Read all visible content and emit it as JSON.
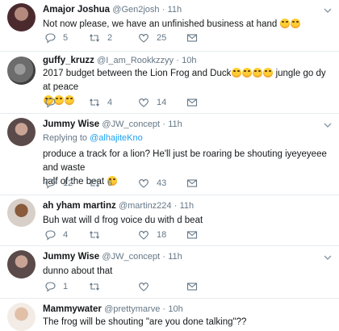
{
  "tweets": [
    {
      "name": "Amajor Joshua",
      "handle": "@Gen2josh",
      "time": "11h",
      "text": "Not now please, we have an unfinished business at hand",
      "emojis": "😂😂",
      "replies": "5",
      "retweets": "2",
      "likes": "25"
    },
    {
      "name": "guffy_kruzz",
      "handle": "@I_am_Rookkzzyy",
      "time": "10h",
      "text_line1": "2017 budget between the Lion Frog and Duck",
      "text_line1_emojis": "😂😂😂😂",
      "text_line1_tail": " jungle go dy at peace",
      "text_line2_emojis": "😂😂😂",
      "replies": "",
      "retweets": "4",
      "likes": "14"
    },
    {
      "name": "Jummy Wise",
      "handle": "@JW_concept",
      "time": "11h",
      "replying_prefix": "Replying to",
      "replying_to": "@alhajiteKno",
      "text_line1": "produce a track for a lion? He'll just be roaring be shouting iyeyeyeee and waste",
      "text_line2": "half of the beat",
      "emoji": "🙄",
      "replies": "12",
      "retweets": "6",
      "likes": "43"
    },
    {
      "name": "ah yham martinz",
      "handle": "@martinz224",
      "time": "11h",
      "text": "Buh wat will d frog voice du with d beat",
      "replies": "4",
      "retweets": "",
      "likes": "18"
    },
    {
      "name": "Jummy Wise",
      "handle": "@JW_concept",
      "time": "11h",
      "text": "dunno about that",
      "replies": "1",
      "retweets": "",
      "likes": ""
    },
    {
      "name": "Mammywater",
      "handle": "@prettymarve",
      "time": "10h",
      "text": "The frog will be shouting \"are you done talking\"??"
    }
  ],
  "separator": "·",
  "colors": {
    "text": "#14171a",
    "muted": "#657786",
    "link": "#1da1f2",
    "border": "#e6ecf0"
  },
  "icons": [
    "reply-icon",
    "retweet-icon",
    "like-icon",
    "message-icon",
    "chevron-down-icon"
  ]
}
